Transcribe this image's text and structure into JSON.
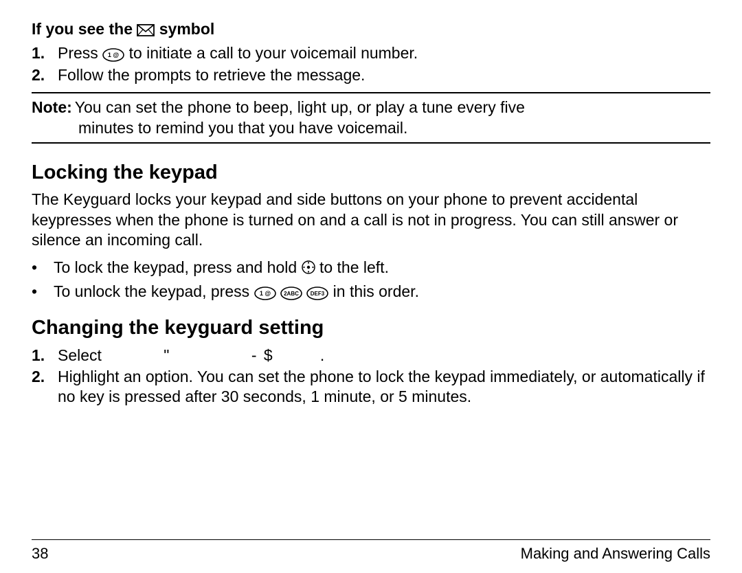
{
  "section_voicemail": {
    "subhead_prefix": "If you see the",
    "subhead_suffix": " symbol",
    "steps": [
      {
        "marker": "1.",
        "prefix": "Press ",
        "suffix": " to initiate a call to your voicemail number."
      },
      {
        "marker": "2.",
        "text": "Follow the prompts to retrieve the message."
      }
    ],
    "note_label": "Note:",
    "note_line1": "You can set the phone to beep, light up, or play a tune every five",
    "note_line2": "minutes to remind you that you have voicemail."
  },
  "section_locking": {
    "heading": "Locking the keypad",
    "paragraph": "The Keyguard locks your keypad and side buttons on your phone to prevent accidental keypresses when the phone is turned on and a call is not in progress. You can still answer or silence an incoming call.",
    "bullet1_prefix": "To lock the keypad, press and hold ",
    "bullet1_suffix": " to the left.",
    "bullet2_prefix": "To unlock the keypad, press ",
    "bullet2_suffix": " in this order."
  },
  "section_changing": {
    "heading": "Changing the keyguard setting",
    "step1_marker": "1.",
    "step1_prefix": "Select ",
    "step1_menu": "          \"              - $        .",
    "step2_marker": "2.",
    "step2_text": "Highlight an option. You can set the phone to lock the keypad immediately, or automatically if no key is pressed after 30 seconds, 1 minute, or 5 minutes."
  },
  "footer": {
    "page_number": "38",
    "chapter": "Making and Answering Calls"
  },
  "icons": {
    "key1_label": "1",
    "key2_label": "2ABC",
    "key3_label": "DEF3"
  }
}
